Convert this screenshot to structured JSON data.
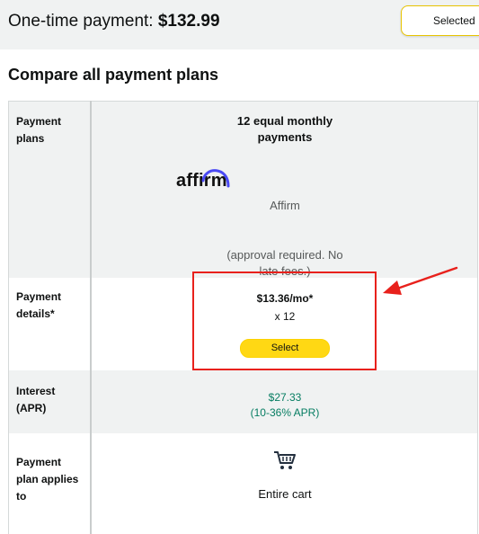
{
  "header": {
    "one_time_label": "One-time payment:",
    "one_time_price": "$132.99",
    "selected_label": "Selected"
  },
  "compare": {
    "heading": "Compare all payment plans"
  },
  "table": {
    "rows": {
      "plans": {
        "label_line1": "Payment",
        "label_line2": "plans"
      },
      "details": {
        "label_line1": "Payment",
        "label_line2": "details*"
      },
      "interest": {
        "label_line1": "Interest",
        "label_line2": "(APR)"
      },
      "applies": {
        "label_line1": "Payment",
        "label_line2": "plan applies",
        "label_line3": "to"
      }
    },
    "plan": {
      "title_line1": "12 equal monthly",
      "title_line2": "payments",
      "logo_text": "affirm",
      "provider": "Affirm",
      "note_line1": "(approval required. No",
      "note_line2": "late fees.)",
      "monthly": "$13.36/mo*",
      "count": "x 12",
      "select_label": "Select",
      "interest_amount": "$27.33",
      "interest_apr": "(10-36% APR)",
      "applies_to": "Entire cart"
    }
  },
  "icons": {
    "logo": "affirm-logo",
    "cart": "shopping-cart-icon",
    "annotation": "red-arrow"
  },
  "colors": {
    "select_button": "#ffd814",
    "interest_green": "#067d62",
    "annotation_red": "#e8211c",
    "affirm_arc": "#4a4af4"
  }
}
